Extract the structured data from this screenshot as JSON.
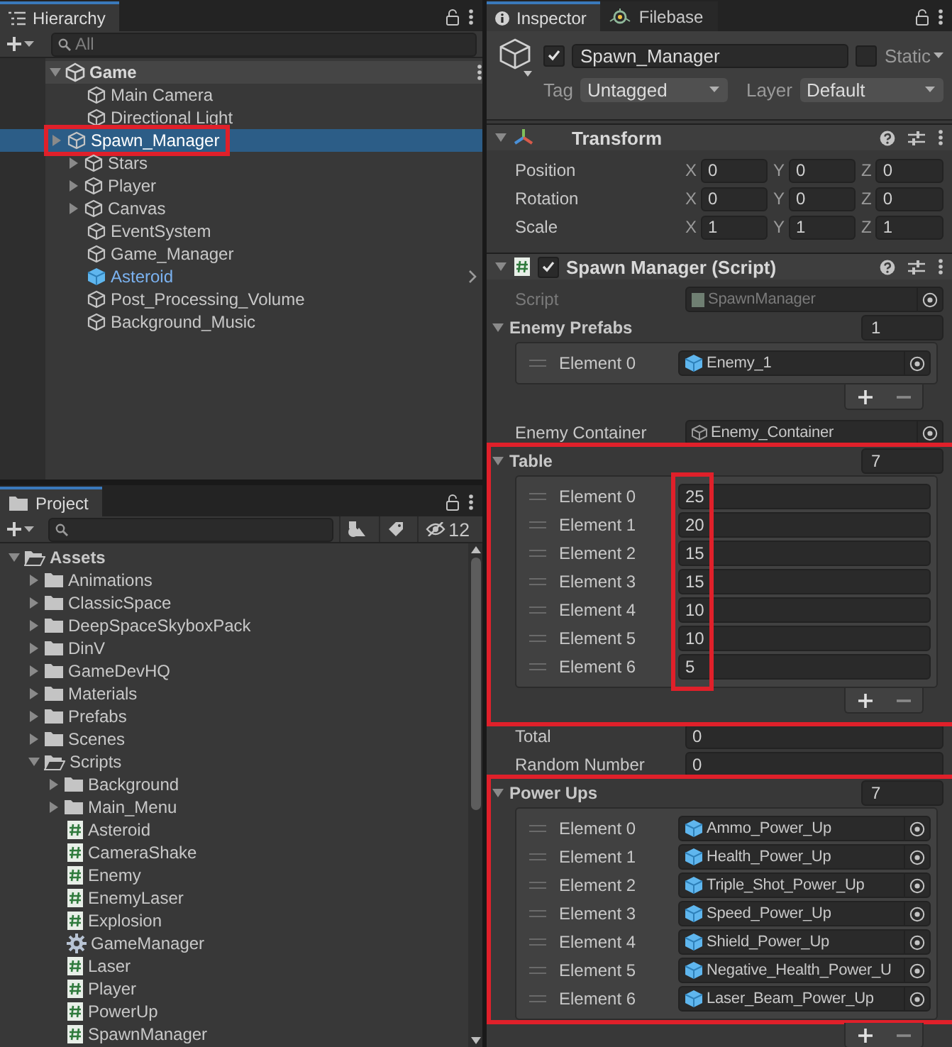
{
  "hierarchy": {
    "tab": "Hierarchy",
    "search": {
      "placeholder": "All"
    },
    "scene": {
      "name": "Game",
      "expanded": true
    },
    "items": [
      {
        "name": "Main Camera",
        "has_children": false,
        "selected": false,
        "prefab": false,
        "highlighted": false
      },
      {
        "name": "Directional Light",
        "has_children": false,
        "selected": false,
        "prefab": false,
        "highlighted": false
      },
      {
        "name": "Spawn_Manager",
        "has_children": true,
        "selected": true,
        "prefab": false,
        "highlighted": true
      },
      {
        "name": "Stars",
        "has_children": true,
        "selected": false,
        "prefab": false,
        "highlighted": false
      },
      {
        "name": "Player",
        "has_children": true,
        "selected": false,
        "prefab": false,
        "highlighted": false
      },
      {
        "name": "Canvas",
        "has_children": true,
        "selected": false,
        "prefab": false,
        "highlighted": false
      },
      {
        "name": "EventSystem",
        "has_children": false,
        "selected": false,
        "prefab": false,
        "highlighted": false
      },
      {
        "name": "Game_Manager",
        "has_children": false,
        "selected": false,
        "prefab": false,
        "highlighted": false
      },
      {
        "name": "Asteroid",
        "has_children": false,
        "selected": false,
        "prefab": true,
        "highlighted": false
      },
      {
        "name": "Post_Processing_Volume",
        "has_children": false,
        "selected": false,
        "prefab": false,
        "highlighted": false
      },
      {
        "name": "Background_Music",
        "has_children": false,
        "selected": false,
        "prefab": false,
        "highlighted": false
      }
    ]
  },
  "project": {
    "tab": "Project",
    "hidden_count": "12",
    "tree": [
      {
        "name": "Assets",
        "kind": "folder",
        "expanded": true,
        "children": [
          {
            "name": "Animations",
            "kind": "folder",
            "expanded": false
          },
          {
            "name": "ClassicSpace",
            "kind": "folder",
            "expanded": false
          },
          {
            "name": "DeepSpaceSkyboxPack",
            "kind": "folder",
            "expanded": false
          },
          {
            "name": "DinV",
            "kind": "folder",
            "expanded": false
          },
          {
            "name": "GameDevHQ",
            "kind": "folder",
            "expanded": false
          },
          {
            "name": "Materials",
            "kind": "folder",
            "expanded": false
          },
          {
            "name": "Prefabs",
            "kind": "folder",
            "expanded": false
          },
          {
            "name": "Scenes",
            "kind": "folder",
            "expanded": false
          },
          {
            "name": "Scripts",
            "kind": "folder",
            "expanded": true,
            "children": [
              {
                "name": "Background",
                "kind": "folder",
                "expanded": false
              },
              {
                "name": "Main_Menu",
                "kind": "folder",
                "expanded": false
              },
              {
                "name": "Asteroid",
                "kind": "script"
              },
              {
                "name": "CameraShake",
                "kind": "script"
              },
              {
                "name": "Enemy",
                "kind": "script"
              },
              {
                "name": "EnemyLaser",
                "kind": "script"
              },
              {
                "name": "Explosion",
                "kind": "script"
              },
              {
                "name": "GameManager",
                "kind": "settings"
              },
              {
                "name": "Laser",
                "kind": "script"
              },
              {
                "name": "Player",
                "kind": "script"
              },
              {
                "name": "PowerUp",
                "kind": "script"
              },
              {
                "name": "SpawnManager",
                "kind": "script"
              }
            ]
          }
        ]
      }
    ]
  },
  "inspector": {
    "tabs": [
      {
        "label": "Inspector",
        "selected": true
      },
      {
        "label": "Filebase",
        "selected": false
      }
    ],
    "object": {
      "active": true,
      "name": "Spawn_Manager",
      "static": false,
      "static_label": "Static",
      "tag_label": "Tag",
      "tag": "Untagged",
      "layer_label": "Layer",
      "layer": "Default"
    },
    "components": [
      {
        "kind": "transform",
        "title": "Transform",
        "expanded": true,
        "rows": [
          {
            "label": "Position",
            "values": [
              {
                "axis": "X",
                "value": "0"
              },
              {
                "axis": "Y",
                "value": "0"
              },
              {
                "axis": "Z",
                "value": "0"
              }
            ]
          },
          {
            "label": "Rotation",
            "values": [
              {
                "axis": "X",
                "value": "0"
              },
              {
                "axis": "Y",
                "value": "0"
              },
              {
                "axis": "Z",
                "value": "0"
              }
            ]
          },
          {
            "label": "Scale",
            "values": [
              {
                "axis": "X",
                "value": "1"
              },
              {
                "axis": "Y",
                "value": "1"
              },
              {
                "axis": "Z",
                "value": "1"
              }
            ]
          }
        ]
      },
      {
        "kind": "script",
        "title": "Spawn Manager (Script)",
        "enabled": true,
        "expanded": true,
        "fields": [
          {
            "kind": "script_ref",
            "label": "Script",
            "value": "SpawnManager"
          },
          {
            "kind": "object_list",
            "label": "Enemy Prefabs",
            "size": "1",
            "expanded": true,
            "highlighted": false,
            "elements": [
              {
                "label": "Element 0",
                "value": "Enemy_1"
              }
            ]
          },
          {
            "kind": "object_ref",
            "label": "Enemy Container",
            "value": "Enemy_Container"
          },
          {
            "kind": "number_list",
            "label": "Table",
            "size": "7",
            "expanded": true,
            "highlighted": true,
            "elements": [
              {
                "label": "Element 0",
                "value": "25"
              },
              {
                "label": "Element 1",
                "value": "20"
              },
              {
                "label": "Element 2",
                "value": "15"
              },
              {
                "label": "Element 3",
                "value": "15"
              },
              {
                "label": "Element 4",
                "value": "10"
              },
              {
                "label": "Element 5",
                "value": "10"
              },
              {
                "label": "Element 6",
                "value": "5"
              }
            ]
          },
          {
            "kind": "value",
            "label": "Total",
            "value": "0"
          },
          {
            "kind": "value",
            "label": "Random Number",
            "value": "0"
          },
          {
            "kind": "object_list",
            "label": "Power Ups",
            "size": "7",
            "expanded": true,
            "highlighted": true,
            "elements": [
              {
                "label": "Element 0",
                "value": "Ammo_Power_Up"
              },
              {
                "label": "Element 1",
                "value": "Health_Power_Up"
              },
              {
                "label": "Element 2",
                "value": "Triple_Shot_Power_Up"
              },
              {
                "label": "Element 3",
                "value": "Speed_Power_Up"
              },
              {
                "label": "Element 4",
                "value": "Shield_Power_Up"
              },
              {
                "label": "Element 5",
                "value": "Negative_Health_Power_U"
              },
              {
                "label": "Element 6",
                "value": "Laser_Beam_Power_Up"
              }
            ]
          }
        ]
      }
    ]
  }
}
